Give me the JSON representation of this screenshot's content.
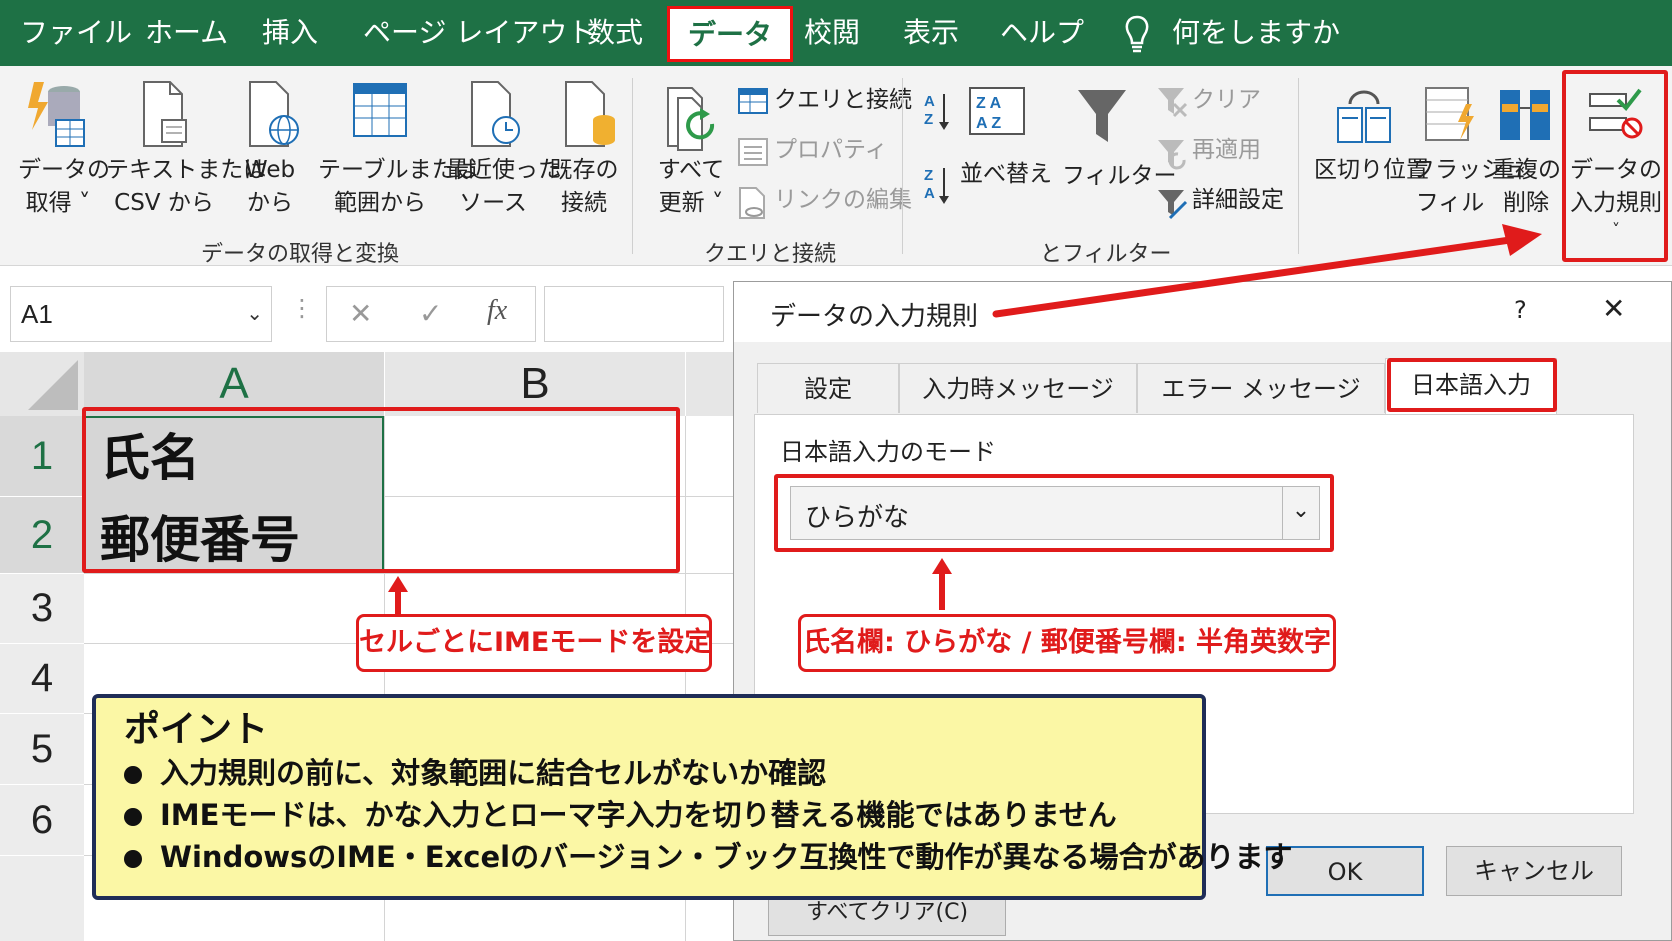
{
  "menubar": {
    "items": [
      "ファイル",
      "ホーム",
      "挿入",
      "ページ レイアウト",
      "数式",
      "データ",
      "校閲",
      "表示",
      "ヘルプ"
    ],
    "tell_me": "何をしますか"
  },
  "ribbon": {
    "get_data": {
      "line1": "データの",
      "line2": "取得 ˅"
    },
    "text_csv": {
      "line1": "テキストまたは",
      "line2": "CSV から"
    },
    "web": {
      "line1": "Web",
      "line2": "から"
    },
    "table_range": {
      "line1": "テーブルまたは",
      "line2": "範囲から"
    },
    "recent": {
      "line1": "最近使った",
      "line2": "ソース"
    },
    "existing": {
      "line1": "既存の",
      "line2": "接続"
    },
    "group1_label": "データの取得と変換",
    "refresh_all": {
      "line1": "すべて",
      "line2": "更新 ˅"
    },
    "queries_connections": "クエリと接続",
    "properties": "プロパティ",
    "edit_links": "リンクの編集",
    "group2_label": "クエリと接続",
    "sort": "並べ替え",
    "filter": "フィルター",
    "clear": "クリア",
    "reapply": "再適用",
    "advanced": "詳細設定",
    "group3_label": "とフィルター",
    "text_to_columns": {
      "line1": "区切り位置"
    },
    "flash_fill": {
      "line1": "フラッシュ",
      "line2": "フィル"
    },
    "remove_duplicates": {
      "line1": "重複の",
      "line2": "削除"
    },
    "data_validation": {
      "line1": "データの",
      "line2": "入力規則",
      "line3": "˅"
    }
  },
  "formula_bar": {
    "name_box": "A1",
    "fx": "fx"
  },
  "sheet": {
    "columns": [
      "A",
      "B"
    ],
    "rows": [
      "1",
      "2",
      "3",
      "4",
      "5",
      "6"
    ],
    "cells": {
      "A1": "氏名",
      "A2": "郵便番号"
    }
  },
  "callouts": {
    "left": "セルごとにIMEモードを設定",
    "right": "氏名欄: ひらがな / 郵便番号欄: 半角英数字"
  },
  "dialog": {
    "title": "データの入力規則",
    "help": "?",
    "close": "✕",
    "tabs": [
      "設定",
      "入力時メッセージ",
      "エラー メッセージ",
      "日本語入力"
    ],
    "mode_label": "日本語入力のモード",
    "mode_value": "ひらがな",
    "clear_all": "すべてクリア(C)",
    "ok": "OK",
    "cancel": "キャンセル"
  },
  "point": {
    "title": "ポイント",
    "items": [
      "入力規則の前に、対象範囲に結合セルがないか確認",
      "IMEモードは、かな入力とローマ字入力を切り替える機能ではありません",
      "WindowsのIME・Excelのバージョン・ブック互換性で動作が異なる場合があります"
    ]
  },
  "colors": {
    "excel_green": "#1e7145",
    "highlight_red": "#e01b1b",
    "note_yellow": "#fbf7a5",
    "note_border": "#1f2d57"
  }
}
